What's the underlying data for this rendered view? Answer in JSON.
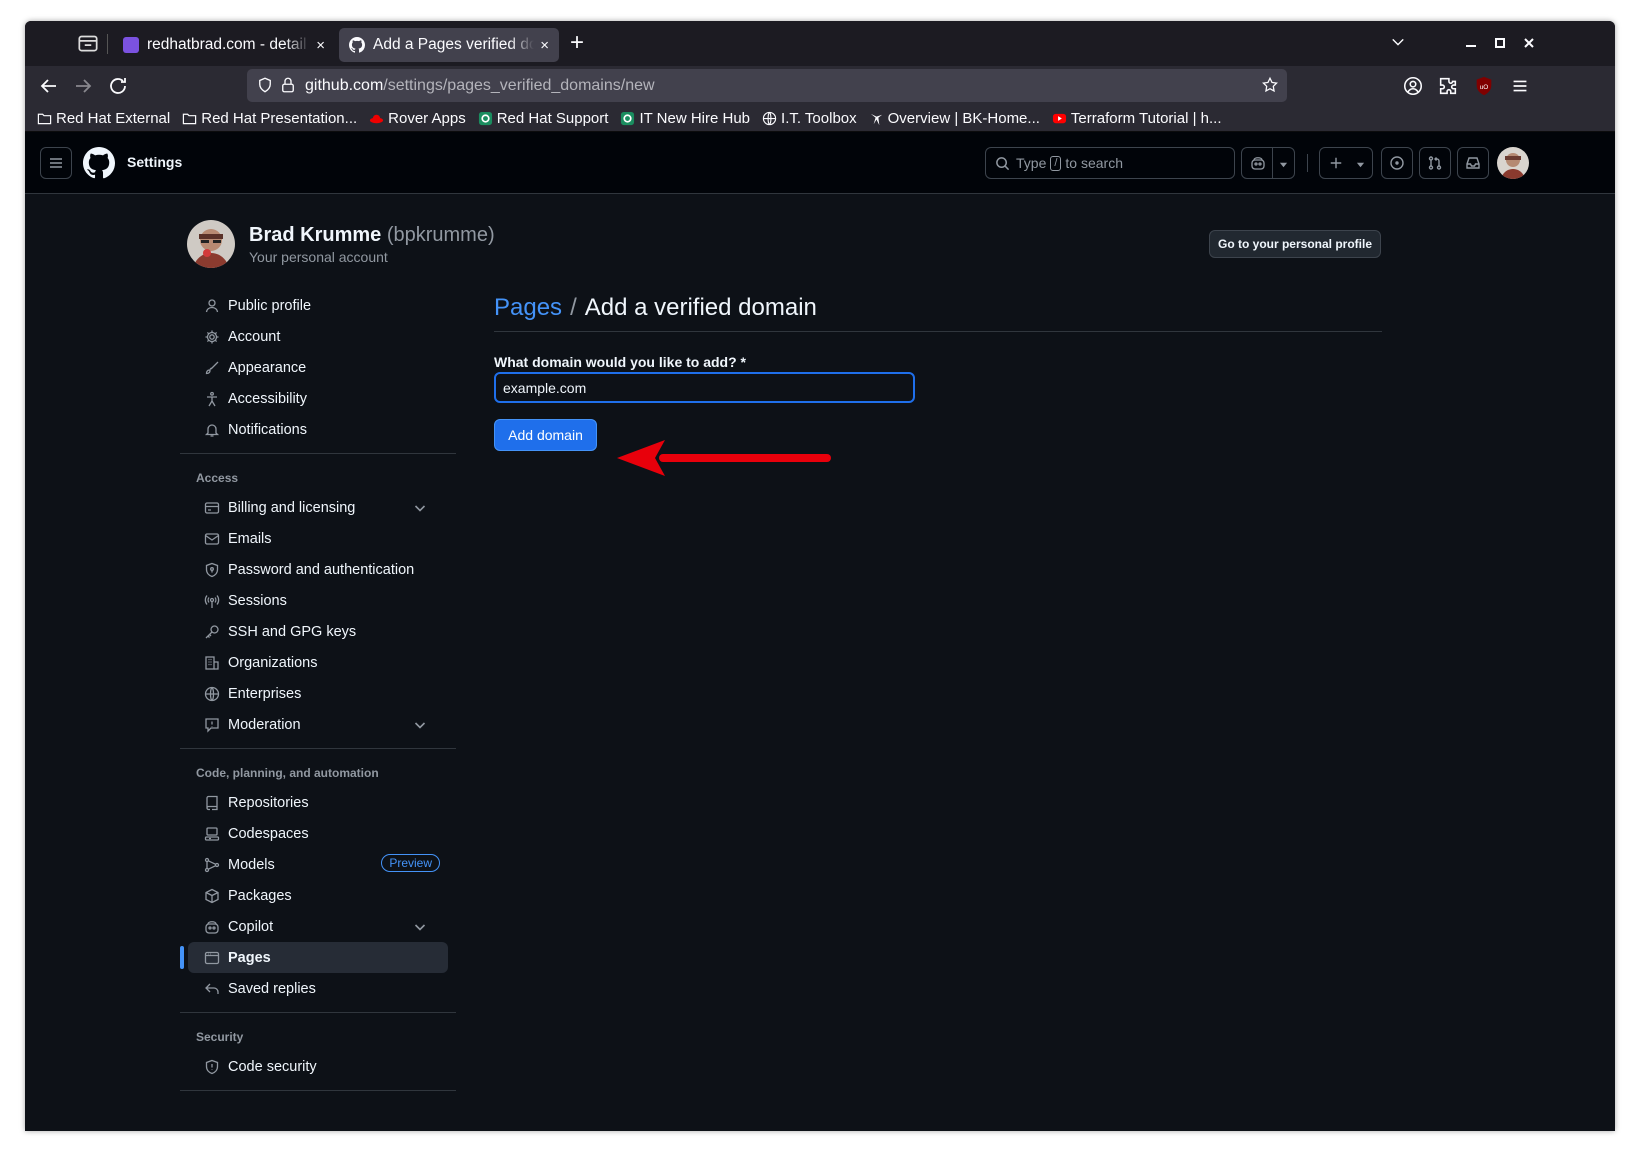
{
  "browser": {
    "tabs": [
      {
        "title": "redhatbrad.com - detail",
        "active": false,
        "favicon_color": "#7b52e0"
      },
      {
        "title": "Add a Pages verified do",
        "active": true,
        "favicon_color": "#fbfbfe"
      }
    ],
    "close_glyph": "×",
    "new_tab_glyph": "+",
    "url_host": "github.com",
    "url_path": "/settings/pages_verified_domains/new",
    "bookmarks": [
      {
        "label": "Red Hat External",
        "icon": "folder-icon"
      },
      {
        "label": "Red Hat Presentation...",
        "icon": "folder-icon"
      },
      {
        "label": "Rover Apps",
        "icon": "redhat-icon"
      },
      {
        "label": "Red Hat Support",
        "icon": "support-icon"
      },
      {
        "label": "IT New Hire Hub",
        "icon": "support-icon"
      },
      {
        "label": "I.T. Toolbox",
        "icon": "globe-icon"
      },
      {
        "label": "Overview | BK-Home...",
        "icon": "chart-icon"
      },
      {
        "label": "Terraform Tutorial | h...",
        "icon": "youtube-icon"
      }
    ]
  },
  "gh_header": {
    "title": "Settings",
    "search_prefix": "Type",
    "search_key": "/",
    "search_suffix": "to search"
  },
  "profile": {
    "name": "Brad Krumme",
    "login": "(bpkrumme)",
    "subtitle": "Your personal account",
    "go_profile_label": "Go to your personal profile"
  },
  "sidebar": {
    "top_items": [
      {
        "label": "Public profile",
        "icon": "person-icon"
      },
      {
        "label": "Account",
        "icon": "gear-icon"
      },
      {
        "label": "Appearance",
        "icon": "paintbrush-icon"
      },
      {
        "label": "Accessibility",
        "icon": "accessibility-icon"
      },
      {
        "label": "Notifications",
        "icon": "bell-icon"
      }
    ],
    "access_heading": "Access",
    "access_items": [
      {
        "label": "Billing and licensing",
        "icon": "credit-card-icon",
        "expandable": true
      },
      {
        "label": "Emails",
        "icon": "mail-icon"
      },
      {
        "label": "Password and authentication",
        "icon": "shield-icon"
      },
      {
        "label": "Sessions",
        "icon": "broadcast-icon"
      },
      {
        "label": "SSH and GPG keys",
        "icon": "key-icon"
      },
      {
        "label": "Organizations",
        "icon": "organization-icon"
      },
      {
        "label": "Enterprises",
        "icon": "globe-icon"
      },
      {
        "label": "Moderation",
        "icon": "report-icon",
        "expandable": true
      }
    ],
    "code_heading": "Code, planning, and automation",
    "code_items": [
      {
        "label": "Repositories",
        "icon": "repo-icon"
      },
      {
        "label": "Codespaces",
        "icon": "codespaces-icon"
      },
      {
        "label": "Models",
        "icon": "models-icon",
        "badge": "Preview"
      },
      {
        "label": "Packages",
        "icon": "package-icon"
      },
      {
        "label": "Copilot",
        "icon": "copilot-icon",
        "expandable": true
      },
      {
        "label": "Pages",
        "icon": "browser-icon",
        "selected": true
      },
      {
        "label": "Saved replies",
        "icon": "reply-icon"
      }
    ],
    "security_heading": "Security",
    "security_items": [
      {
        "label": "Code security",
        "icon": "shield-icon"
      }
    ]
  },
  "main": {
    "breadcrumb_link": "Pages",
    "breadcrumb_sep": "/",
    "breadcrumb_current": "Add a verified domain",
    "field_label": "What domain would you like to add? *",
    "field_value": "example.com",
    "submit_label": "Add domain"
  },
  "colors": {
    "accent": "#1f6feb",
    "link": "#4493f8",
    "annotation_arrow": "#e8000b"
  }
}
